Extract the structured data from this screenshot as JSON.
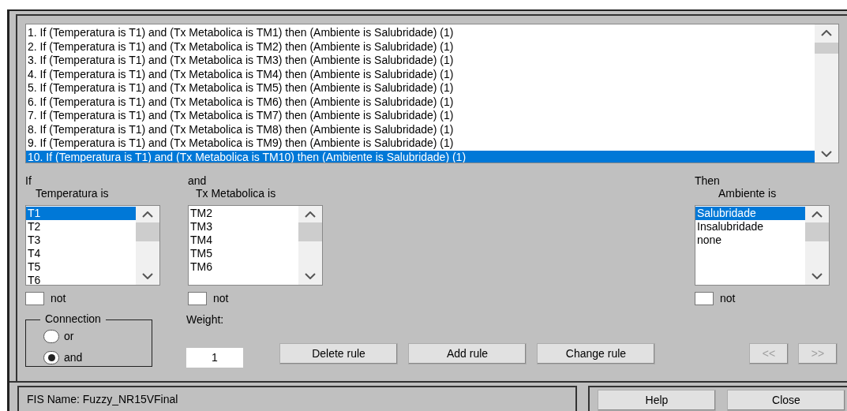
{
  "rules": [
    {
      "text": "1. If (Temperatura is T1) and (Tx Metabolica is TM1) then (Ambiente is Salubridade) (1)",
      "selected": false
    },
    {
      "text": "2. If (Temperatura is T1) and (Tx Metabolica is TM2) then (Ambiente is Salubridade) (1)",
      "selected": false
    },
    {
      "text": "3. If (Temperatura is T1) and (Tx Metabolica is TM3) then (Ambiente is Salubridade) (1)",
      "selected": false
    },
    {
      "text": "4. If (Temperatura is T1) and (Tx Metabolica is TM4) then (Ambiente is Salubridade) (1)",
      "selected": false
    },
    {
      "text": "5. If (Temperatura is T1) and (Tx Metabolica is TM5) then (Ambiente is Salubridade) (1)",
      "selected": false
    },
    {
      "text": "6. If (Temperatura is T1) and (Tx Metabolica is TM6) then (Ambiente is Salubridade) (1)",
      "selected": false
    },
    {
      "text": "7. If (Temperatura is T1) and (Tx Metabolica is TM7) then (Ambiente is Salubridade) (1)",
      "selected": false
    },
    {
      "text": "8. If (Temperatura is T1) and (Tx Metabolica is TM8) then (Ambiente is Salubridade) (1)",
      "selected": false
    },
    {
      "text": "9. If (Temperatura is T1) and (Tx Metabolica is TM9) then (Ambiente is Salubridade) (1)",
      "selected": false
    },
    {
      "text": "10. If (Temperatura is T1) and (Tx Metabolica is TM10) then (Ambiente is Salubridade) (1)",
      "selected": true
    }
  ],
  "inputs": [
    {
      "header": "If",
      "label": "Temperatura is",
      "items": [
        {
          "label": "T1",
          "selected": true
        },
        {
          "label": "T2",
          "selected": false
        },
        {
          "label": "T3",
          "selected": false
        },
        {
          "label": "T4",
          "selected": false
        },
        {
          "label": "T5",
          "selected": false
        },
        {
          "label": "T6",
          "selected": false
        }
      ],
      "not": {
        "label": "not",
        "checked": false
      }
    },
    {
      "header": "and",
      "label": "Tx Metabolica is",
      "items": [
        {
          "label": "TM2",
          "selected": false
        },
        {
          "label": "TM3",
          "selected": false
        },
        {
          "label": "TM4",
          "selected": false
        },
        {
          "label": "TM5",
          "selected": false
        },
        {
          "label": "TM6",
          "selected": false
        }
      ],
      "not": {
        "label": "not",
        "checked": false
      }
    }
  ],
  "output": {
    "header": "Then",
    "label": "Ambiente is",
    "items": [
      {
        "label": "Salubridade",
        "selected": true
      },
      {
        "label": "Insalubridade",
        "selected": false
      },
      {
        "label": "none",
        "selected": false
      }
    ],
    "not": {
      "label": "not",
      "checked": false
    }
  },
  "connection": {
    "title": "Connection",
    "options": [
      {
        "label": "or",
        "selected": false
      },
      {
        "label": "and",
        "selected": true
      }
    ]
  },
  "weight": {
    "label": "Weight:",
    "value": "1"
  },
  "rule_buttons": [
    {
      "label": "Delete rule",
      "disabled": false
    },
    {
      "label": "Add rule",
      "disabled": false
    },
    {
      "label": "Change rule",
      "disabled": false
    }
  ],
  "nav_buttons": [
    {
      "label": "<<",
      "disabled": true
    },
    {
      "label": ">>",
      "disabled": true
    }
  ],
  "status": "FIS Name: Fuzzy_NR15VFinal",
  "footer_buttons": [
    {
      "label": "Help",
      "disabled": false
    },
    {
      "label": "Close",
      "disabled": false
    }
  ]
}
